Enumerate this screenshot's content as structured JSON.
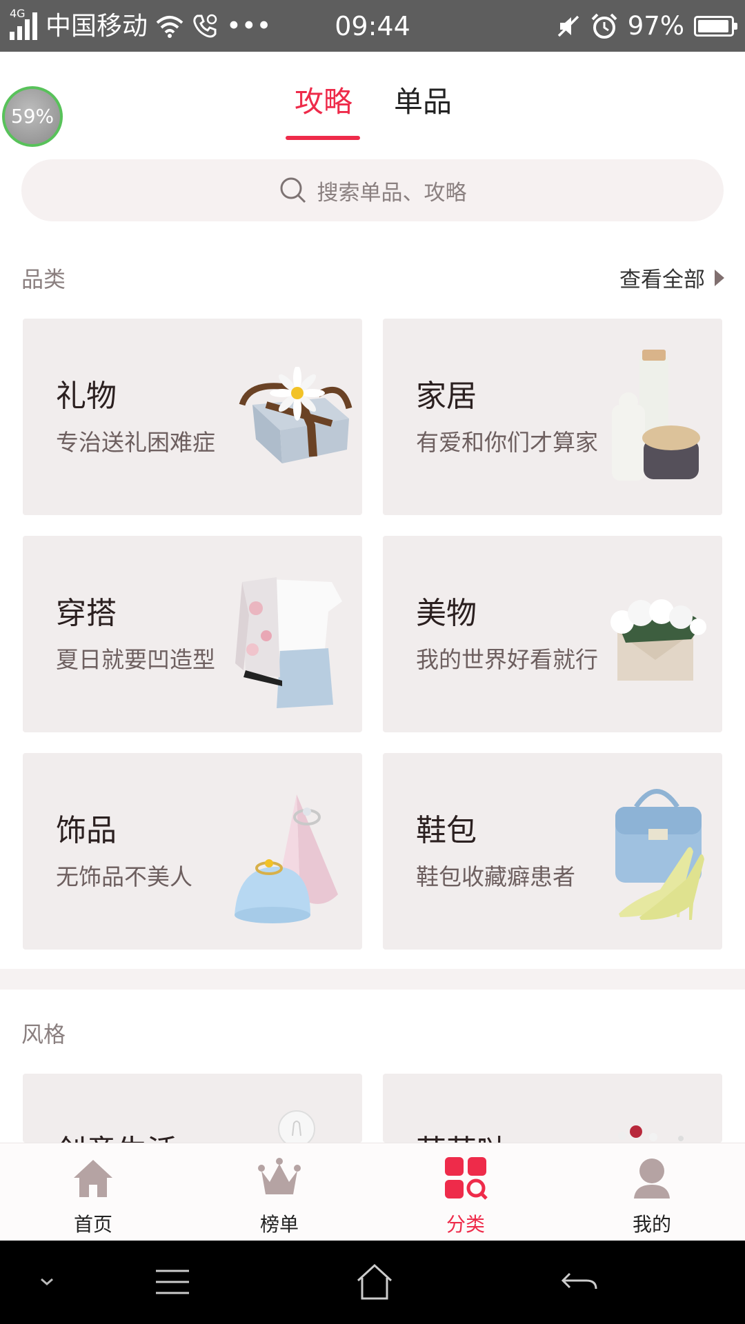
{
  "status_bar": {
    "network": "4G",
    "carrier": "中国移动",
    "extra": "•••",
    "time": "09:44",
    "battery": "97%",
    "battery_level": 0.97
  },
  "overlay": {
    "progress": "59%"
  },
  "tabs": [
    {
      "label": "攻略",
      "active": true
    },
    {
      "label": "单品",
      "active": false
    }
  ],
  "search": {
    "placeholder": "搜索单品、攻略"
  },
  "categories_section": {
    "title": "品类",
    "see_all": "查看全部",
    "items": [
      {
        "title": "礼物",
        "subtitle": "专治送礼困难症",
        "image": "gift-box-with-daisy"
      },
      {
        "title": "家居",
        "subtitle": "有爱和你们才算家",
        "image": "ceramic-vases"
      },
      {
        "title": "穿搭",
        "subtitle": "夏日就要凹造型",
        "image": "floral-jacket-outfit"
      },
      {
        "title": "美物",
        "subtitle": "我的世界好看就行",
        "image": "envelope-with-flowers"
      },
      {
        "title": "饰品",
        "subtitle": "无饰品不美人",
        "image": "rings-on-cones"
      },
      {
        "title": "鞋包",
        "subtitle": "鞋包收藏癖患者",
        "image": "bag-and-heels"
      }
    ]
  },
  "style_section": {
    "title": "风格",
    "items": [
      {
        "title": "创意生活",
        "image": "light-bulb"
      },
      {
        "title": "萌萌哒",
        "image": "cute-toys"
      }
    ]
  },
  "bottom_nav": [
    {
      "label": "首页",
      "icon": "home-icon",
      "active": false
    },
    {
      "label": "榜单",
      "icon": "crown-icon",
      "active": false
    },
    {
      "label": "分类",
      "icon": "category-icon",
      "active": true
    },
    {
      "label": "我的",
      "icon": "profile-icon",
      "active": false
    }
  ],
  "colors": {
    "accent": "#ee2b4a",
    "card_bg": "#f1eded",
    "nav_icon": "#b5a3a3"
  }
}
